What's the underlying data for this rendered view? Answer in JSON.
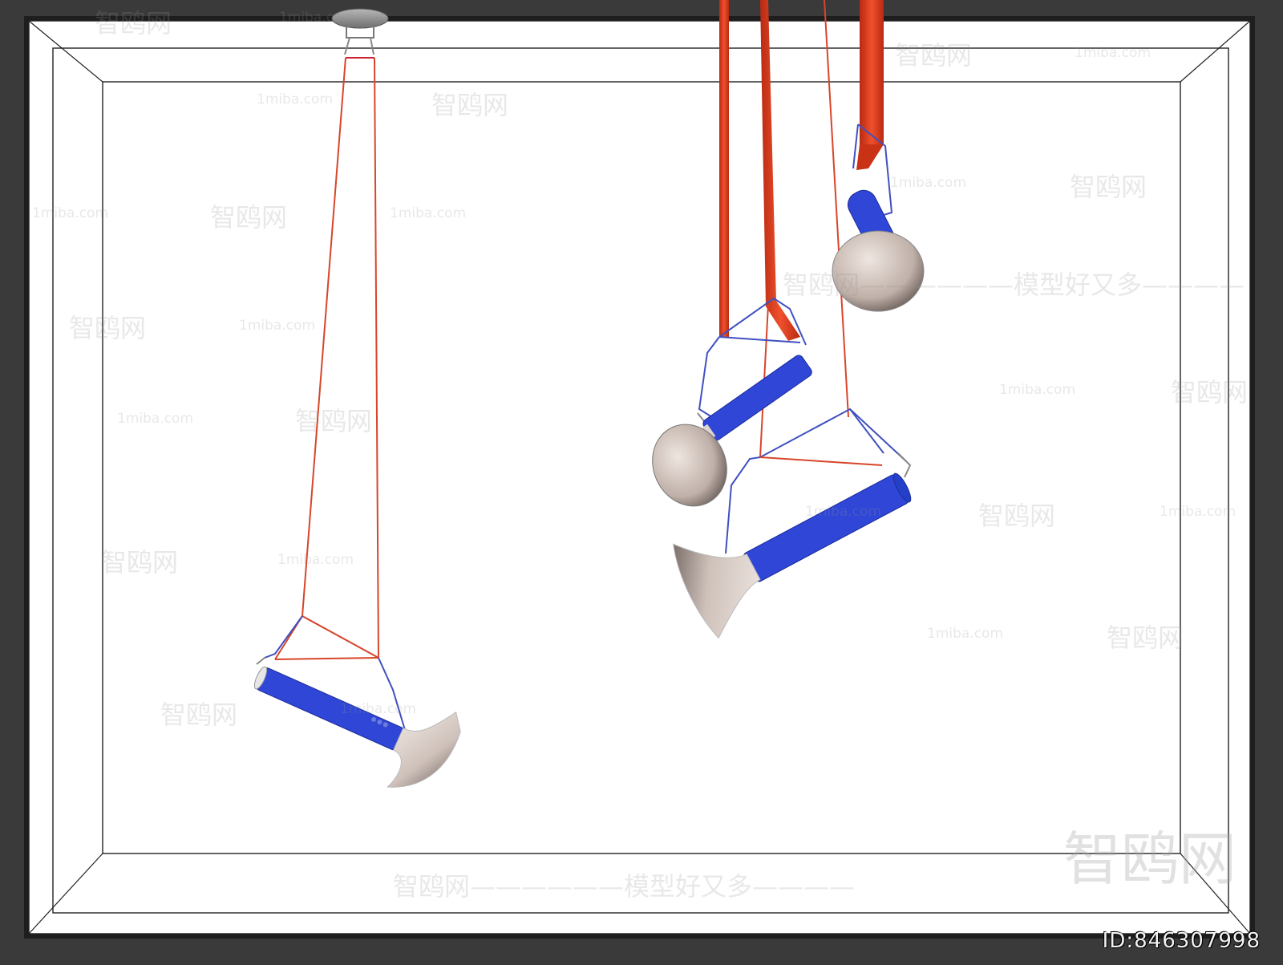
{
  "watermarks": {
    "brand_cn": "智鸥网",
    "domain": "1miba.com",
    "slogan": "智鸥网——————模型好又多————",
    "dash_run": "——————",
    "big_mark": "智鸥网"
  },
  "asset_id": "ID:846307998",
  "colors": {
    "frame_outer": "#3a3a3a",
    "canvas": "#ffffff",
    "cable": "#d8452a",
    "strap": "#e0391c",
    "lamp_body": "#2f46d6",
    "shade": "#e2d5cf",
    "canopy": "#8c8c8c"
  }
}
